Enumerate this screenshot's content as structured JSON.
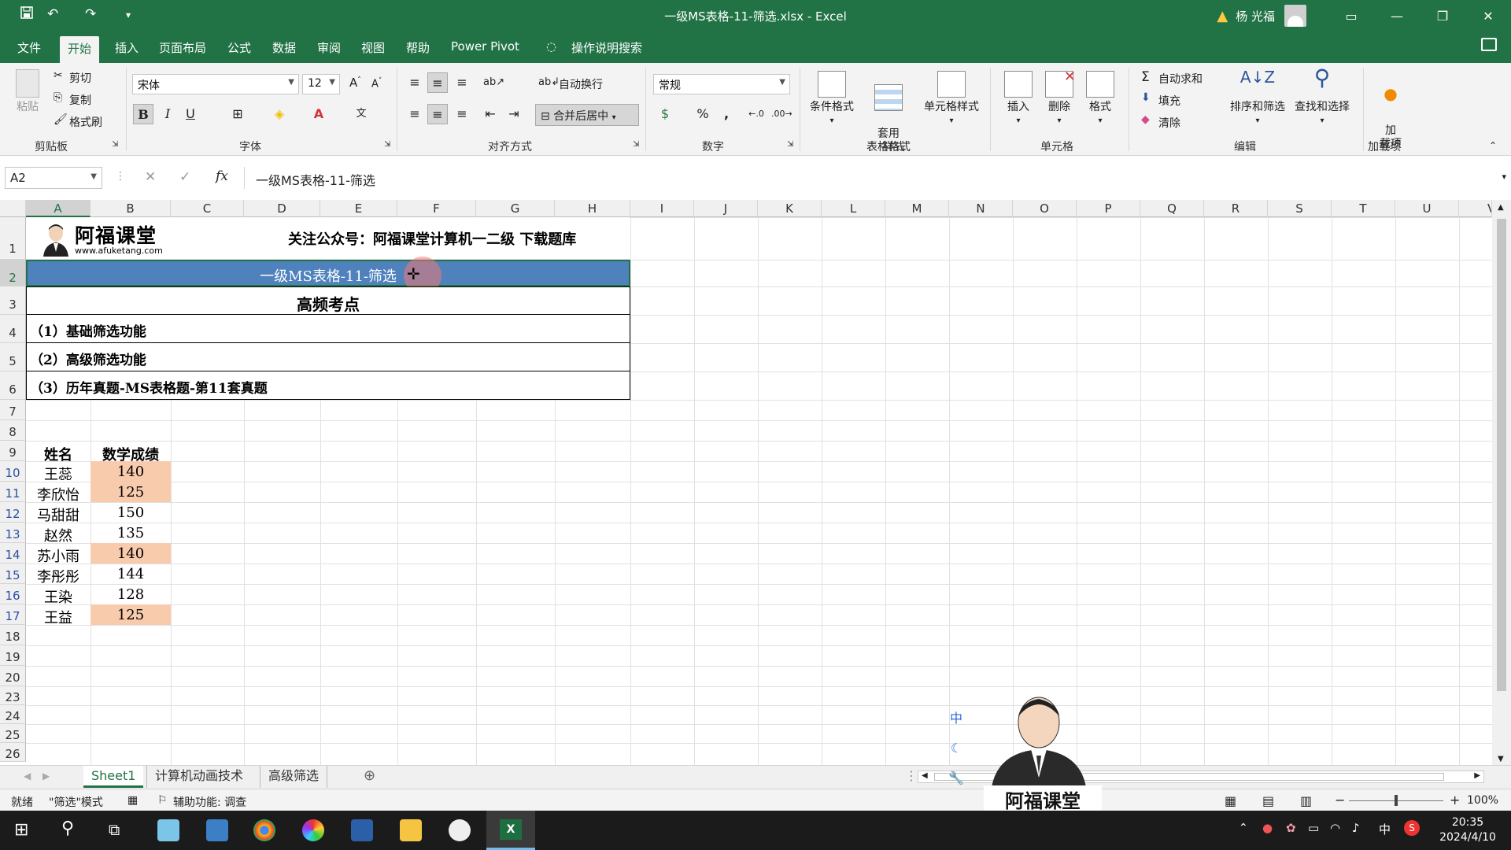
{
  "window": {
    "title": "一级MS表格-11-筛选.xlsx  -  Excel",
    "user": "杨 光福",
    "quick_access": [
      "save-icon",
      "undo-icon",
      "redo-icon",
      "customize-icon"
    ]
  },
  "menu": {
    "tabs": [
      "文件",
      "开始",
      "插入",
      "页面布局",
      "公式",
      "数据",
      "审阅",
      "视图",
      "帮助",
      "Power Pivot"
    ],
    "active": "开始",
    "tell_me": "操作说明搜索"
  },
  "ribbon": {
    "clipboard": {
      "paste": "粘贴",
      "cut": "剪切",
      "copy": "复制",
      "format_painter": "格式刷",
      "label": "剪贴板"
    },
    "font": {
      "name": "宋体",
      "size": "12",
      "label": "字体",
      "bold": "B",
      "italic": "I",
      "underline": "U"
    },
    "alignment": {
      "wrap": "自动换行",
      "merge": "合并后居中",
      "label": "对齐方式"
    },
    "number": {
      "format": "常规",
      "label": "数字"
    },
    "styles": {
      "conditional": "条件格式",
      "table": "套用\n表格格式",
      "cell_styles": "单元格样式",
      "label": "样式"
    },
    "cells": {
      "insert": "插入",
      "delete": "删除",
      "format": "格式",
      "label": "单元格"
    },
    "editing": {
      "autosum": "自动求和",
      "fill": "填充",
      "clear": "清除",
      "sort_filter": "排序和筛选",
      "find_select": "查找和选择",
      "label": "编辑"
    },
    "addins": {
      "addin": "加\n载项",
      "label": "加载项"
    }
  },
  "formula_bar": {
    "name_box": "A2",
    "content": "一级MS表格-11-筛选"
  },
  "columns": [
    "A",
    "B",
    "C",
    "D",
    "E",
    "F",
    "G",
    "H",
    "I",
    "J",
    "K",
    "L",
    "M",
    "N",
    "O",
    "P",
    "Q",
    "R",
    "S",
    "T",
    "U",
    "V"
  ],
  "rows": [
    "1",
    "2",
    "3",
    "4",
    "5",
    "6",
    "7",
    "8",
    "9",
    "10",
    "11",
    "12",
    "13",
    "14",
    "15",
    "16",
    "17",
    "18",
    "19",
    "20",
    "23",
    "24",
    "25",
    "26"
  ],
  "sheet": {
    "logo_title": "阿福课堂",
    "logo_url": "www.afuketang.com",
    "subscribe": "关注公众号：阿福课堂计算机一二级  下载题库",
    "banner": "一级MS表格-11-筛选",
    "section_title": "高频考点",
    "points": [
      "（1）基础筛选功能",
      "（2）高级筛选功能",
      "（3）历年真题-MS表格题-第11套真题"
    ],
    "table_headers": [
      "姓名",
      "数学成绩"
    ],
    "table_rows": [
      {
        "name": "王蕊",
        "score": "140",
        "highlight": true
      },
      {
        "name": "李欣怡",
        "score": "125",
        "highlight": true
      },
      {
        "name": "马甜甜",
        "score": "150",
        "highlight": false
      },
      {
        "name": "赵然",
        "score": "135",
        "highlight": false
      },
      {
        "name": "苏小雨",
        "score": "140",
        "highlight": true
      },
      {
        "name": "李彤彤",
        "score": "144",
        "highlight": false
      },
      {
        "name": "王染",
        "score": "128",
        "highlight": false
      },
      {
        "name": "王益",
        "score": "125",
        "highlight": true
      }
    ],
    "highlight_color": "#f8cbad",
    "banner_color": "#4f81bd"
  },
  "sheet_tabs": [
    "Sheet1",
    "计算机动画技术",
    "高级筛选"
  ],
  "active_sheet": "Sheet1",
  "status": {
    "ready": "就绪",
    "mode": "\"筛选\"模式",
    "accessibility": "辅助功能: 调查",
    "zoom": "100%"
  },
  "overlay": {
    "brand": "阿福课堂",
    "ime": "中"
  },
  "taskbar": {
    "time": "20:35",
    "date": "2024/4/10",
    "ime": "中"
  },
  "colors": {
    "excel_green": "#217346",
    "accent_red": "#d13438"
  }
}
